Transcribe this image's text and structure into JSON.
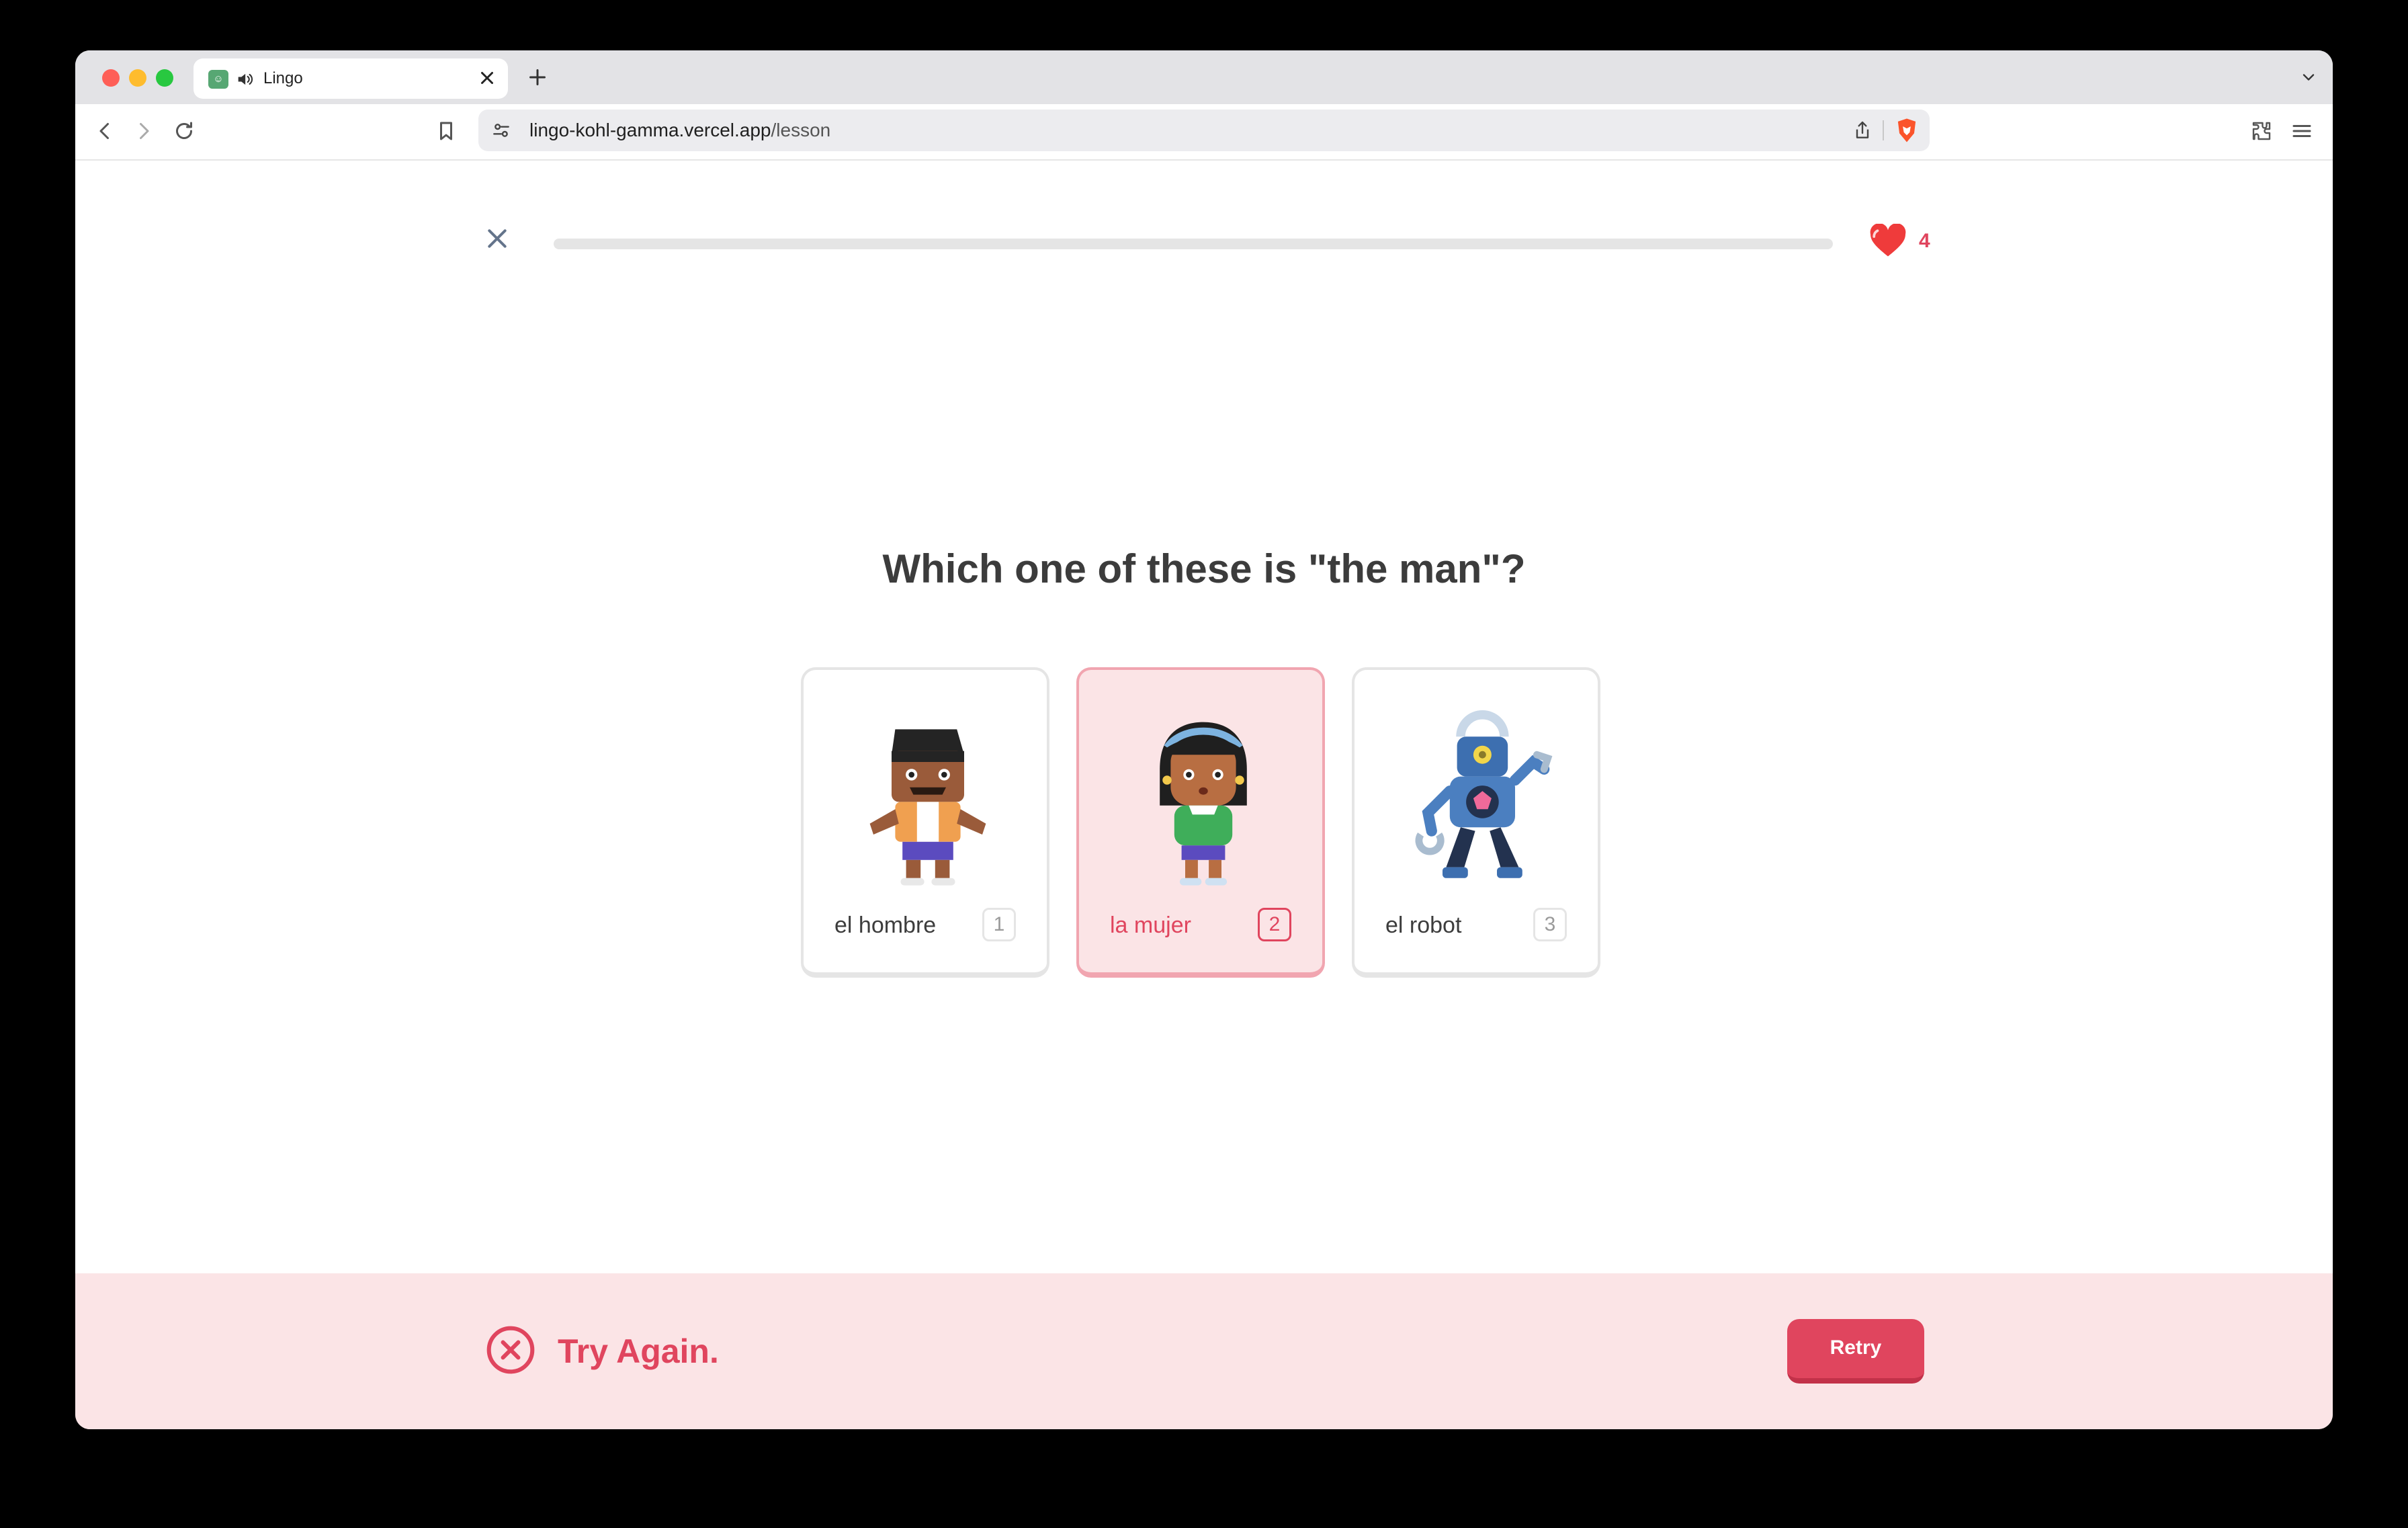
{
  "browser": {
    "tab_title": "Lingo",
    "url_host": "lingo-kohl-gamma.vercel.app",
    "url_path": "/lesson"
  },
  "lesson": {
    "progress_percent": 0,
    "hearts": "4",
    "question": "Which one of these is \"the man\"?",
    "options": [
      {
        "label": "el hombre",
        "shortcut": "1",
        "selected": false,
        "art": "man-illustration"
      },
      {
        "label": "la mujer",
        "shortcut": "2",
        "selected": true,
        "art": "woman-illustration"
      },
      {
        "label": "el robot",
        "shortcut": "3",
        "selected": false,
        "art": "robot-illustration"
      }
    ]
  },
  "footer": {
    "status": "Try Again.",
    "button_label": "Retry",
    "status_icon": "x-circle-icon"
  },
  "colors": {
    "accent_red": "#e0455e",
    "wrong_bg": "#fbe4e6",
    "progress": "#22c55e"
  }
}
